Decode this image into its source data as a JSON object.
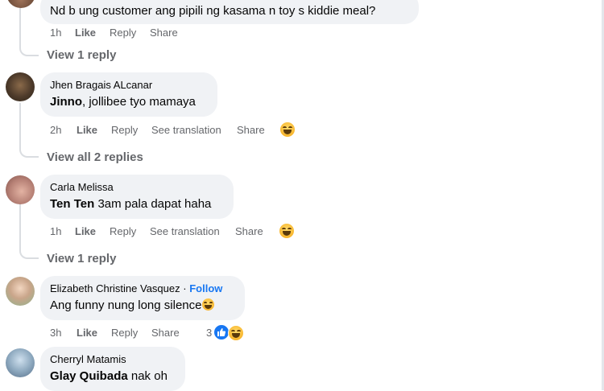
{
  "comments": [
    {
      "text": "Nd b ung customer ang pipili ng kasama n toy s kiddie meal?",
      "actions": [
        "1h",
        "Like",
        "Reply",
        "Share"
      ],
      "view_replies": "View 1 reply"
    },
    {
      "author": "Jhen Bragais ALcanar",
      "mention": "Jinno",
      "text": ", jollibee tyo mamaya",
      "actions": [
        "2h",
        "Like",
        "Reply",
        "See translation",
        "Share"
      ],
      "reaction_icon": "haha-icon",
      "view_replies": "View all 2 replies"
    },
    {
      "author": "Carla Melissa",
      "mention": "Ten Ten",
      "text": " 3am pala dapat haha",
      "actions": [
        "1h",
        "Like",
        "Reply",
        "See translation",
        "Share"
      ],
      "reaction_icon": "haha-icon",
      "view_replies": "View 1 reply"
    },
    {
      "author": "Elizabeth Christine Vasquez",
      "author_separator": "·",
      "follow_label": "Follow",
      "text": "Ang funny nung long silence",
      "actions": [
        "3h",
        "Like",
        "Reply",
        "Share"
      ],
      "reaction_count": "3"
    },
    {
      "author": "Cherryl Matamis",
      "mention": "Glay Quibada",
      "text": " nak oh"
    }
  ],
  "colors": {
    "bubble": "#f0f2f5",
    "meta_text": "#65676b",
    "link_blue": "#1877f2",
    "rail": "#dadde1"
  }
}
